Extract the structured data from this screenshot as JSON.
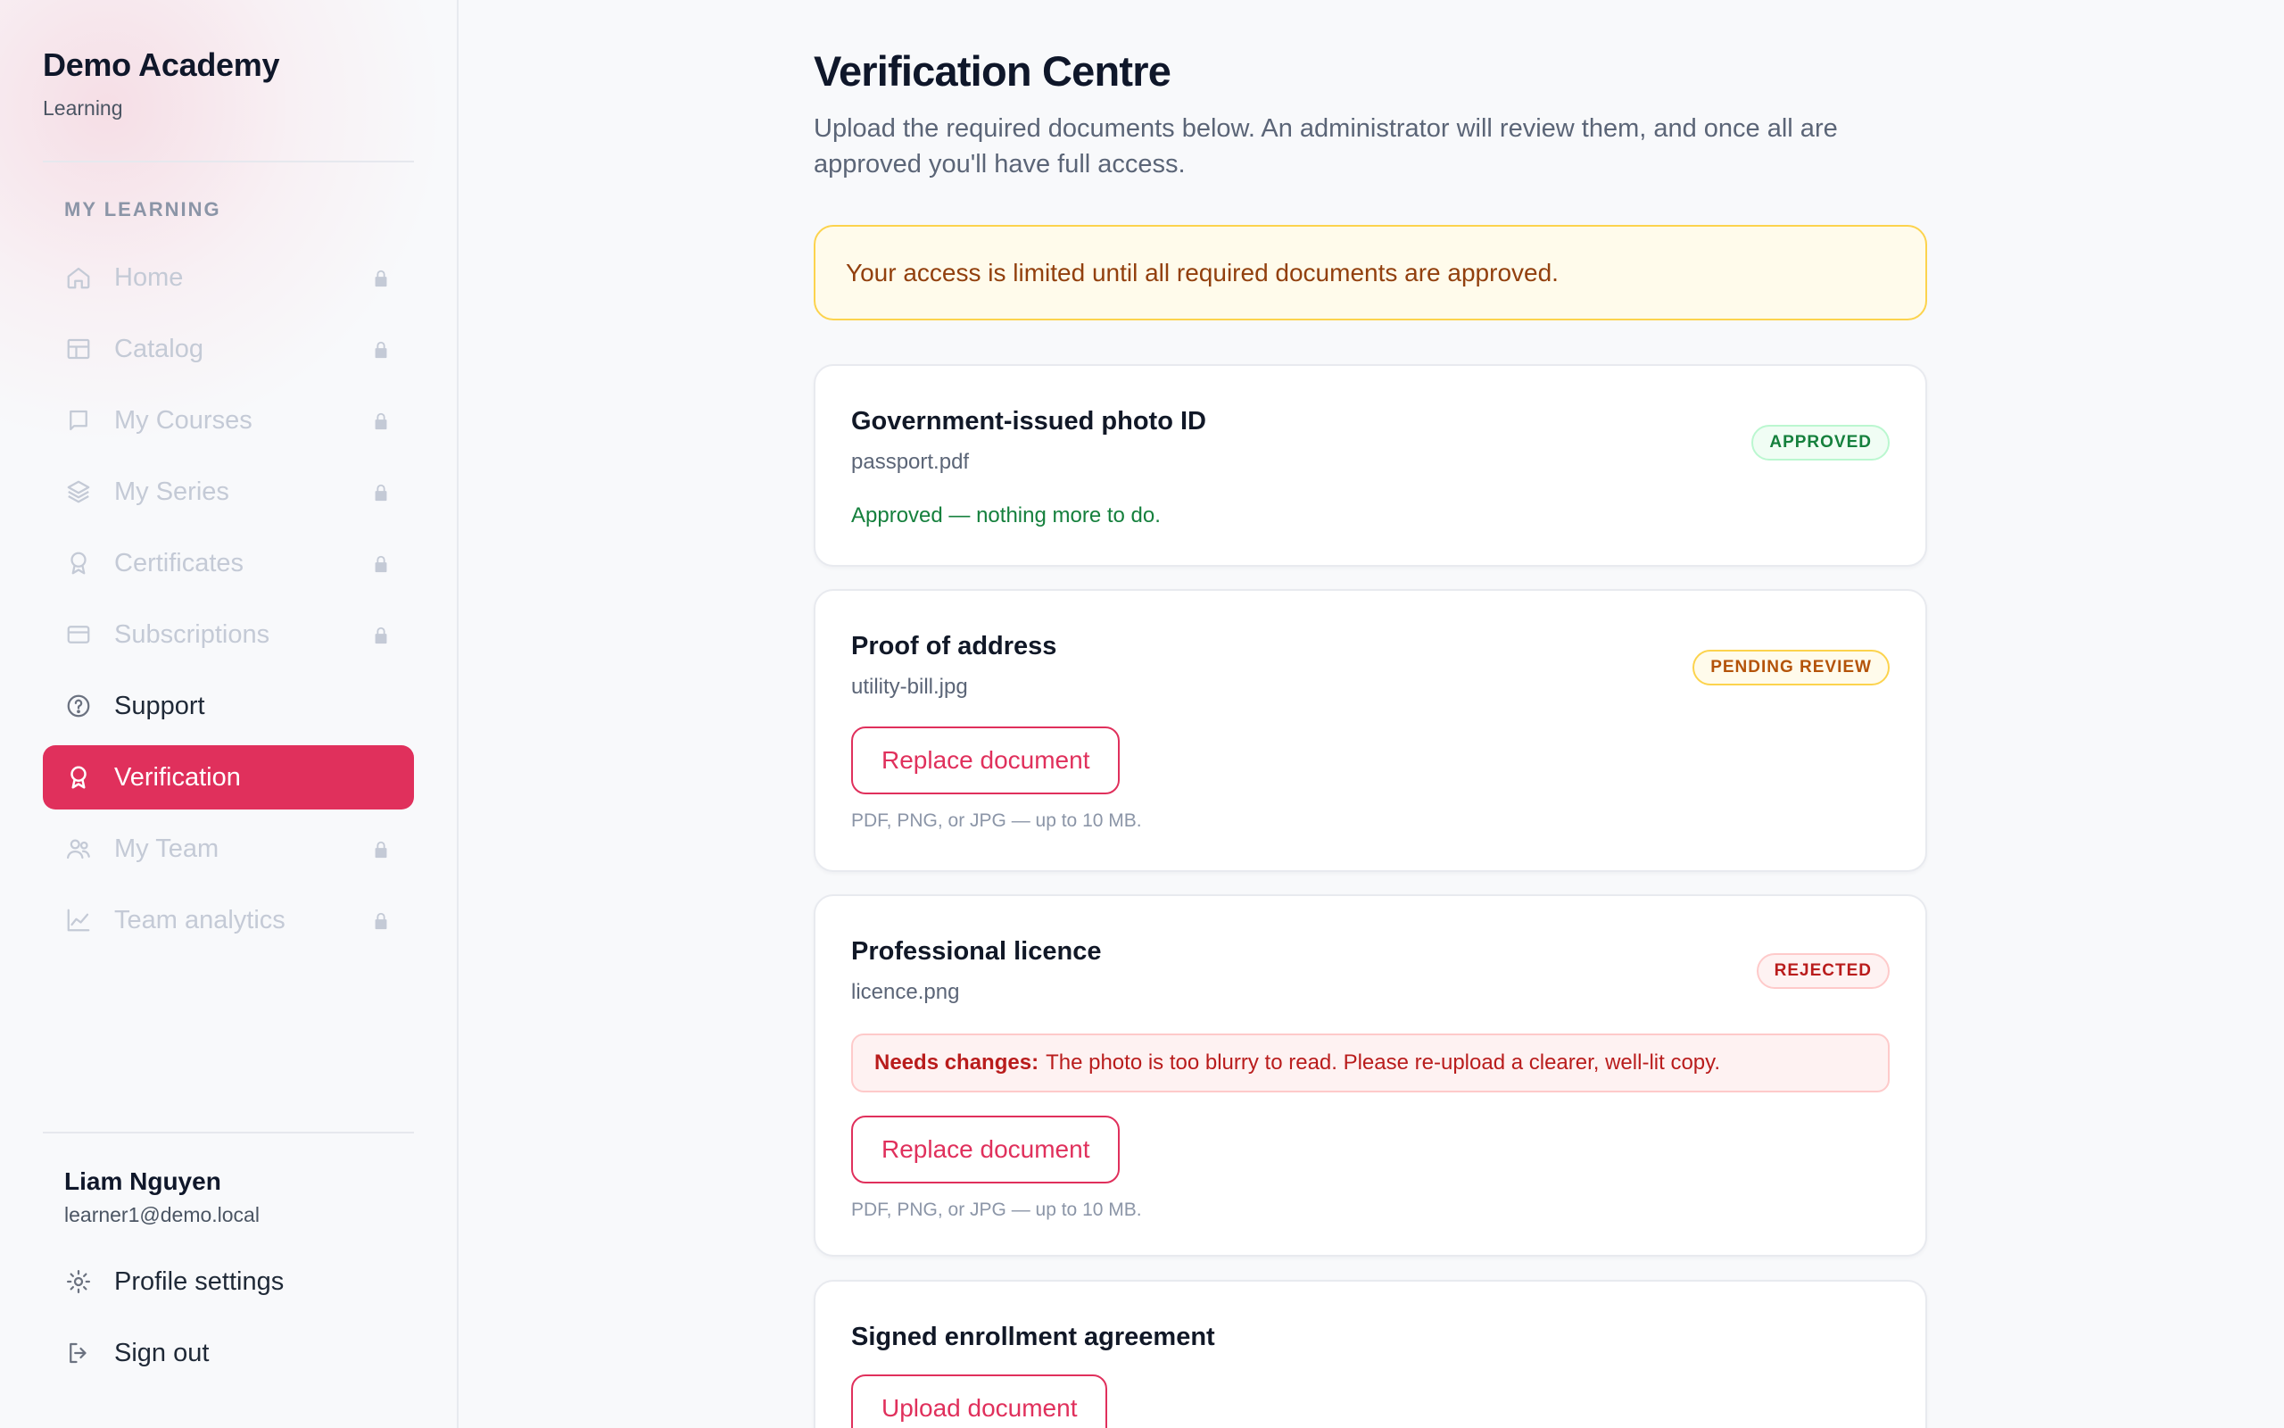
{
  "brand": {
    "title": "Demo Academy",
    "subtitle": "Learning"
  },
  "sidebar": {
    "section_label": "MY LEARNING",
    "items": [
      {
        "label": "Home",
        "icon": "home-icon",
        "state": "locked"
      },
      {
        "label": "Catalog",
        "icon": "catalog-icon",
        "state": "locked"
      },
      {
        "label": "My Courses",
        "icon": "book-icon",
        "state": "locked"
      },
      {
        "label": "My Series",
        "icon": "layers-icon",
        "state": "locked"
      },
      {
        "label": "Certificates",
        "icon": "award-icon",
        "state": "locked"
      },
      {
        "label": "Subscriptions",
        "icon": "card-icon",
        "state": "locked"
      },
      {
        "label": "Support",
        "icon": "help-circle-icon",
        "state": "normal"
      },
      {
        "label": "Verification",
        "icon": "award-icon",
        "state": "active"
      },
      {
        "label": "My Team",
        "icon": "users-icon",
        "state": "locked"
      },
      {
        "label": "Team analytics",
        "icon": "chart-icon",
        "state": "locked"
      }
    ]
  },
  "user": {
    "name": "Liam Nguyen",
    "email": "learner1@demo.local",
    "profile_label": "Profile settings",
    "signout_label": "Sign out"
  },
  "main": {
    "title": "Verification Centre",
    "description": "Upload the required documents below. An administrator will review them, and once all are approved you'll have full access.",
    "banner": "Your access is limited until all required documents are approved.",
    "documents": [
      {
        "title": "Government-issued photo ID",
        "file": "passport.pdf",
        "status": "APPROVED",
        "message": "Approved — nothing more to do."
      },
      {
        "title": "Proof of address",
        "file": "utility-bill.jpg",
        "status": "PENDING REVIEW",
        "button": "Replace document",
        "hint": "PDF, PNG, or JPG — up to 10 MB."
      },
      {
        "title": "Professional licence",
        "file": "licence.png",
        "status": "REJECTED",
        "reject_label": "Needs changes:",
        "reject_text": "The photo is too blurry to read. Please re-upload a clearer, well-lit copy.",
        "button": "Replace document",
        "hint": "PDF, PNG, or JPG — up to 10 MB."
      },
      {
        "title": "Signed enrollment agreement",
        "button": "Upload document"
      }
    ]
  },
  "colors": {
    "accent": "#e0305c",
    "approved": "#15803d",
    "pending": "#b45309",
    "rejected": "#b91c1c"
  }
}
